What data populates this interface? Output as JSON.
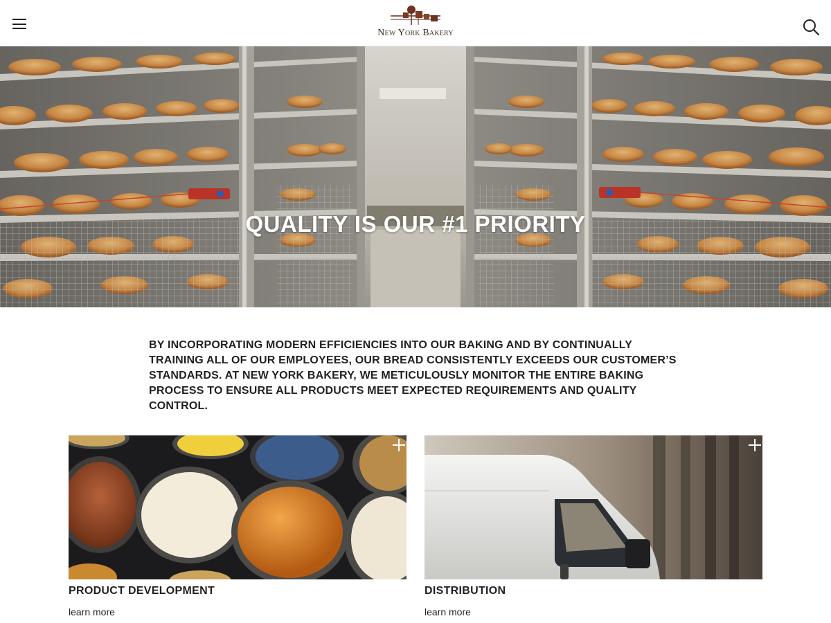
{
  "header": {
    "logo_text": "New York Bakery",
    "menu_icon": "hamburger-menu-icon",
    "search_icon": "search-icon"
  },
  "hero": {
    "title": "QUALITY IS OUR #1 PRIORITY"
  },
  "intro": {
    "text": "BY INCORPORATING MODERN EFFICIENCIES INTO OUR BAKING AND BY CONTINUALLY TRAINING ALL OF OUR EMPLOYEES, OUR BREAD CONSISTENTLY EXCEEDS OUR CUSTOMER’S STANDARDS. AT NEW YORK BAKERY, WE METICULOUSLY MONITOR THE ENTIRE BAKING PROCESS TO ENSURE ALL PRODUCTS MEET EXPECTED REQUIREMENTS AND QUALITY CONTROL."
  },
  "cards": [
    {
      "title": "PRODUCT DEVELOPMENT",
      "link": "learn more",
      "icon": "plus-icon"
    },
    {
      "title": "DISTRIBUTION",
      "link": "learn more",
      "icon": "plus-icon"
    }
  ],
  "colors": {
    "text": "#231f20",
    "brand_brown": "#5a2e1c",
    "background": "#ffffff"
  }
}
